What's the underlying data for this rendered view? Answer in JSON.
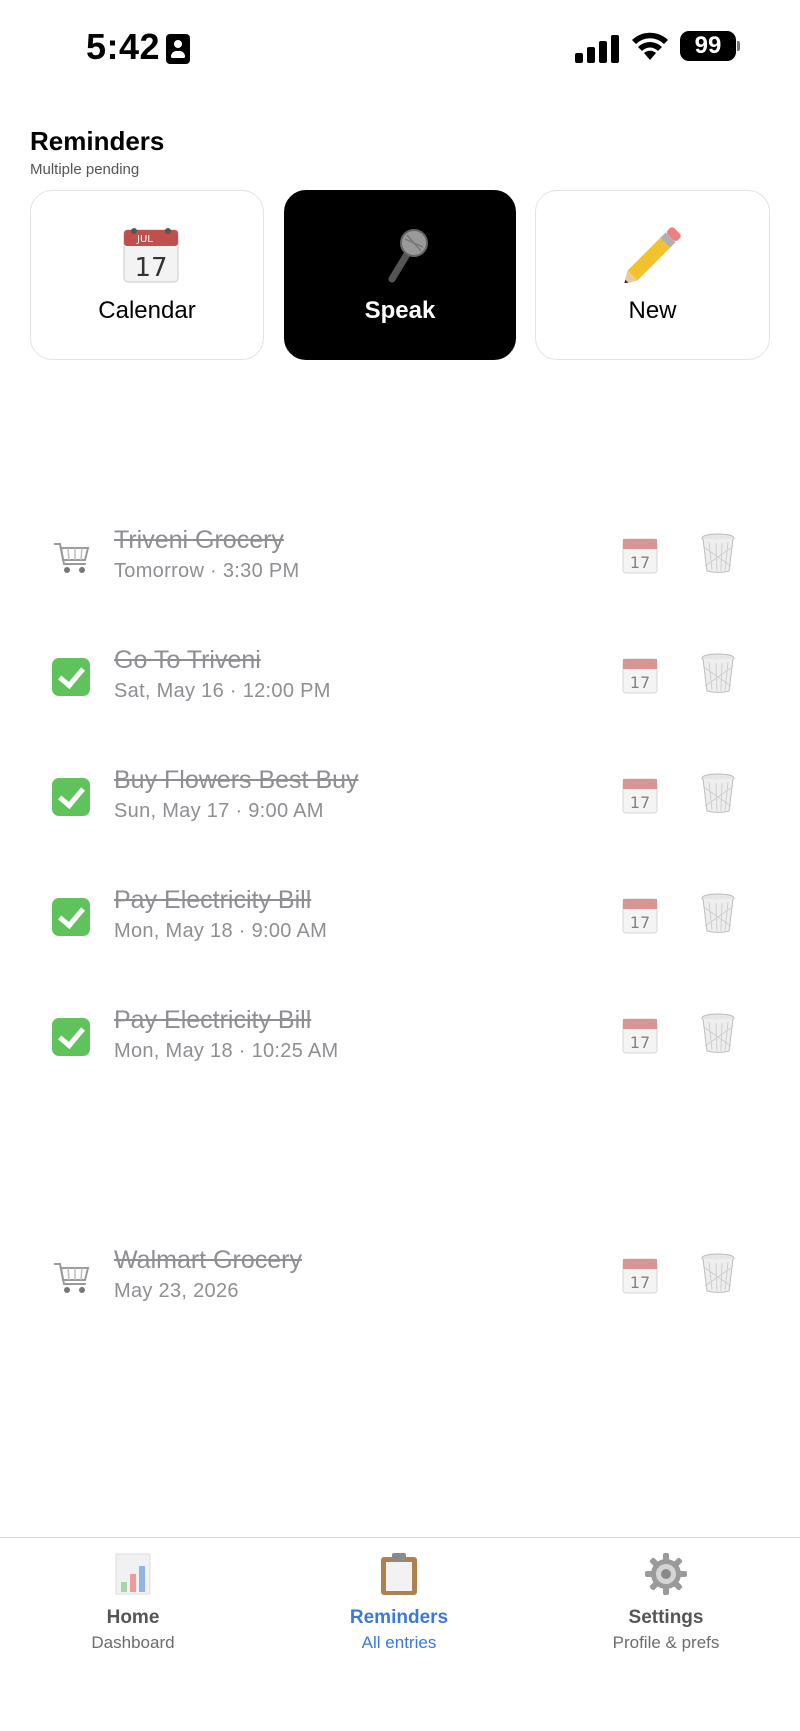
{
  "status_bar": {
    "time": "5:42",
    "battery": "99",
    "icons": [
      "contact-card-icon",
      "signal-icon",
      "wifi-icon",
      "battery-icon"
    ]
  },
  "header": {
    "title": "Reminders",
    "subtitle": "Multiple pending"
  },
  "actions": {
    "calendar": {
      "label": "Calendar",
      "icon": "calendar-icon"
    },
    "speak": {
      "label": "Speak",
      "icon": "microphone-icon"
    },
    "new": {
      "label": "New",
      "icon": "pencil-icon"
    }
  },
  "reminders": [
    {
      "title": "Triveni Grocery",
      "when": "Tomorrow · 3:30 PM",
      "icon": "shopping-cart-icon"
    },
    {
      "title": "Go To Triveni",
      "when": "Sat, May 16 · 12:00 PM",
      "icon": "checkbox-checked-icon"
    },
    {
      "title": "Buy Flowers Best Buy",
      "when": "Sun, May 17 · 9:00 AM",
      "icon": "checkbox-checked-icon"
    },
    {
      "title": "Pay Electricity Bill",
      "when": "Mon, May 18 · 9:00 AM",
      "icon": "checkbox-checked-icon"
    },
    {
      "title": "Pay Electricity Bill",
      "when": "Mon, May 18 · 10:25 AM",
      "icon": "checkbox-checked-icon"
    },
    {
      "title": "Walmart Grocery",
      "when": "May 23, 2026",
      "icon": "shopping-cart-icon"
    }
  ],
  "tabs": {
    "home": {
      "label": "Home",
      "sub": "Dashboard",
      "icon": "bar-chart-icon"
    },
    "reminders": {
      "label": "Reminders",
      "sub": "All entries",
      "icon": "clipboard-icon",
      "active": true
    },
    "settings": {
      "label": "Settings",
      "sub": "Profile & prefs",
      "icon": "gear-icon"
    }
  },
  "colors": {
    "accent": "#3a78e0",
    "done_text": "#8e8e93",
    "check_green": "#5fc25a",
    "speak_bg": "#000000"
  }
}
